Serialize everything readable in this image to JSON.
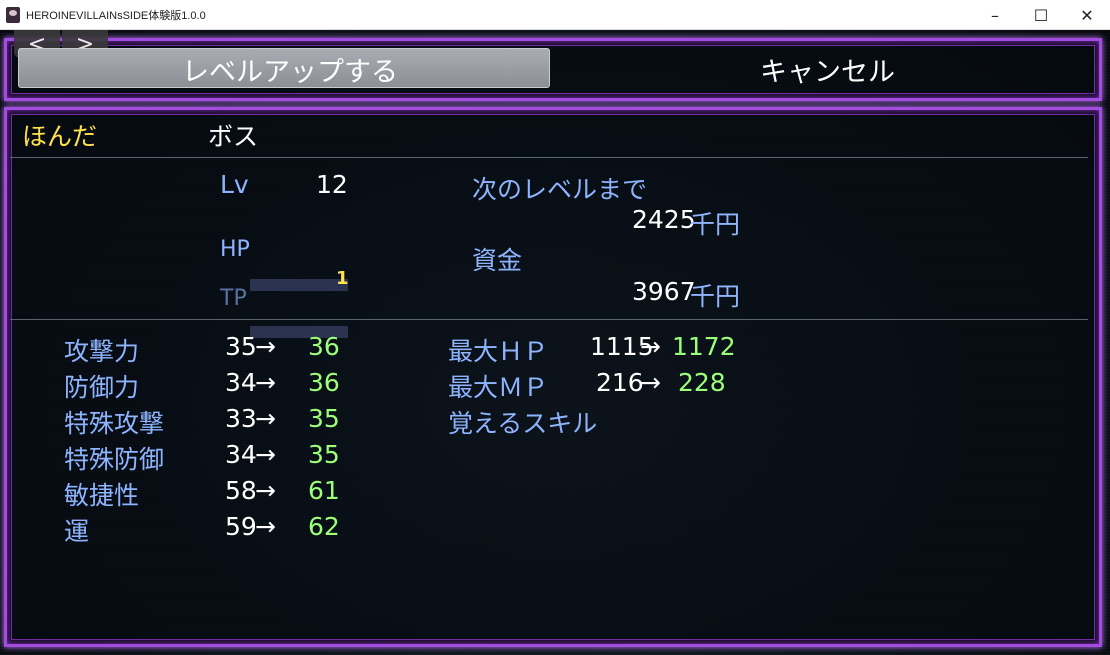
{
  "window": {
    "title": "HEROINEVILLAINsSIDE体験版1.0.0",
    "min_icon": "minimize-icon",
    "max_icon": "maximize-icon",
    "close_icon": "close-icon"
  },
  "nav": {
    "prev": "<",
    "next": ">"
  },
  "commands": {
    "levelup": "レベルアップする",
    "cancel": "キャンセル",
    "selected": "levelup"
  },
  "actor": {
    "name": "ほんだ",
    "class": "ボス",
    "lv_label": "Lv",
    "lv": "12",
    "hp_label": "HP",
    "hp_value": "1",
    "hp_fill": 0,
    "tp_label": "TP",
    "tp_fill": 0
  },
  "next_level": {
    "label": "次のレベルまで",
    "value": "2425",
    "unit": "千円"
  },
  "funds": {
    "label": "資金",
    "value": "3967",
    "unit": "千円"
  },
  "params": [
    {
      "name": "攻撃力",
      "current": "35",
      "next": "36"
    },
    {
      "name": "防御力",
      "current": "34",
      "next": "36"
    },
    {
      "name": "特殊攻撃",
      "current": "33",
      "next": "35"
    },
    {
      "name": "特殊防御",
      "current": "34",
      "next": "35"
    },
    {
      "name": "敏捷性",
      "current": "58",
      "next": "61"
    },
    {
      "name": "運",
      "current": "59",
      "next": "62"
    }
  ],
  "arrow": "→",
  "max_stats": [
    {
      "name": "最大ＨＰ",
      "current": "1115",
      "next": "1172"
    },
    {
      "name": "最大ＭＰ",
      "current": "216",
      "next": "228"
    }
  ],
  "skills_label": "覚えるスキル",
  "colors": {
    "frame": "#a24ce0",
    "highlight": "#ffe14a",
    "label": "#8fb4ff",
    "increase": "#9cff7a"
  }
}
